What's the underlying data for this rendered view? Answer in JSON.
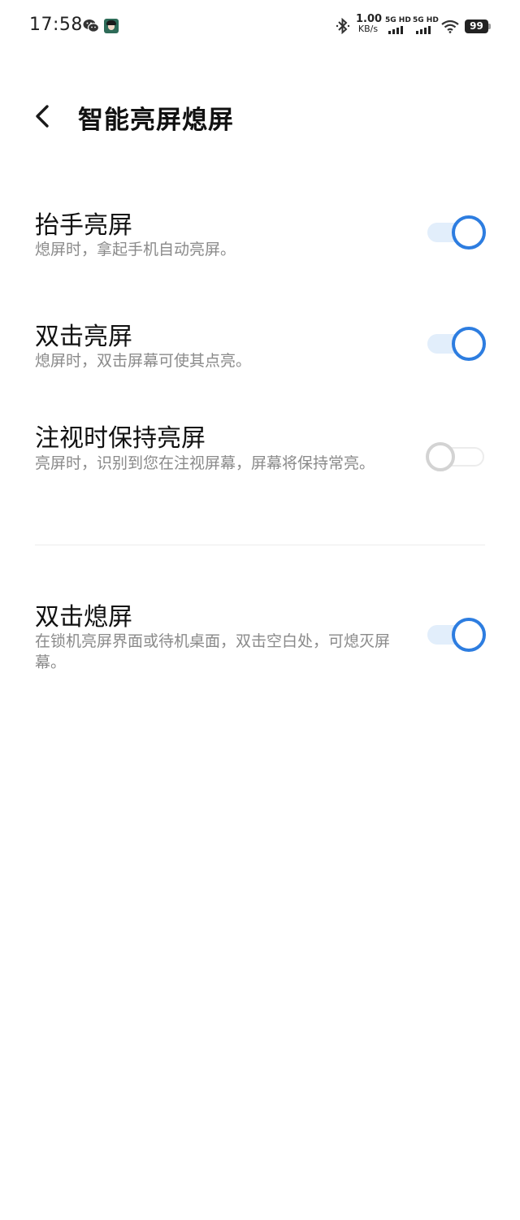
{
  "status_bar": {
    "time": "17:58",
    "network_speed_value": "1.00",
    "network_speed_unit": "KB/s",
    "sim1_label": "5G HD",
    "sim2_label": "5G HD",
    "battery_level": "99",
    "icons": [
      "wechat-icon",
      "app-avatar-icon",
      "bluetooth-icon",
      "signal-icon",
      "signal-icon",
      "wifi-icon",
      "battery-icon"
    ]
  },
  "header": {
    "title": "智能亮屏熄屏",
    "back_icon": "chevron-left-icon"
  },
  "settings": [
    {
      "title": "抬手亮屏",
      "description": "熄屏时，拿起手机自动亮屏。",
      "enabled": true
    },
    {
      "title": "双击亮屏",
      "description": "熄屏时，双击屏幕可使其点亮。",
      "enabled": true
    },
    {
      "title": "注视时保持亮屏",
      "description": "亮屏时，识别到您在注视屏幕，屏幕将保持常亮。",
      "enabled": false
    },
    {
      "title": "双击熄屏",
      "description": "在锁机亮屏界面或待机桌面，双击空白处，可熄灭屏幕。",
      "enabled": true
    }
  ],
  "colors": {
    "accent": "#2d7de0",
    "toggle_track_on": "#e2eefb",
    "toggle_off": "#d3d3d3",
    "description_text": "#8a8a8a",
    "title_text": "#111111"
  }
}
